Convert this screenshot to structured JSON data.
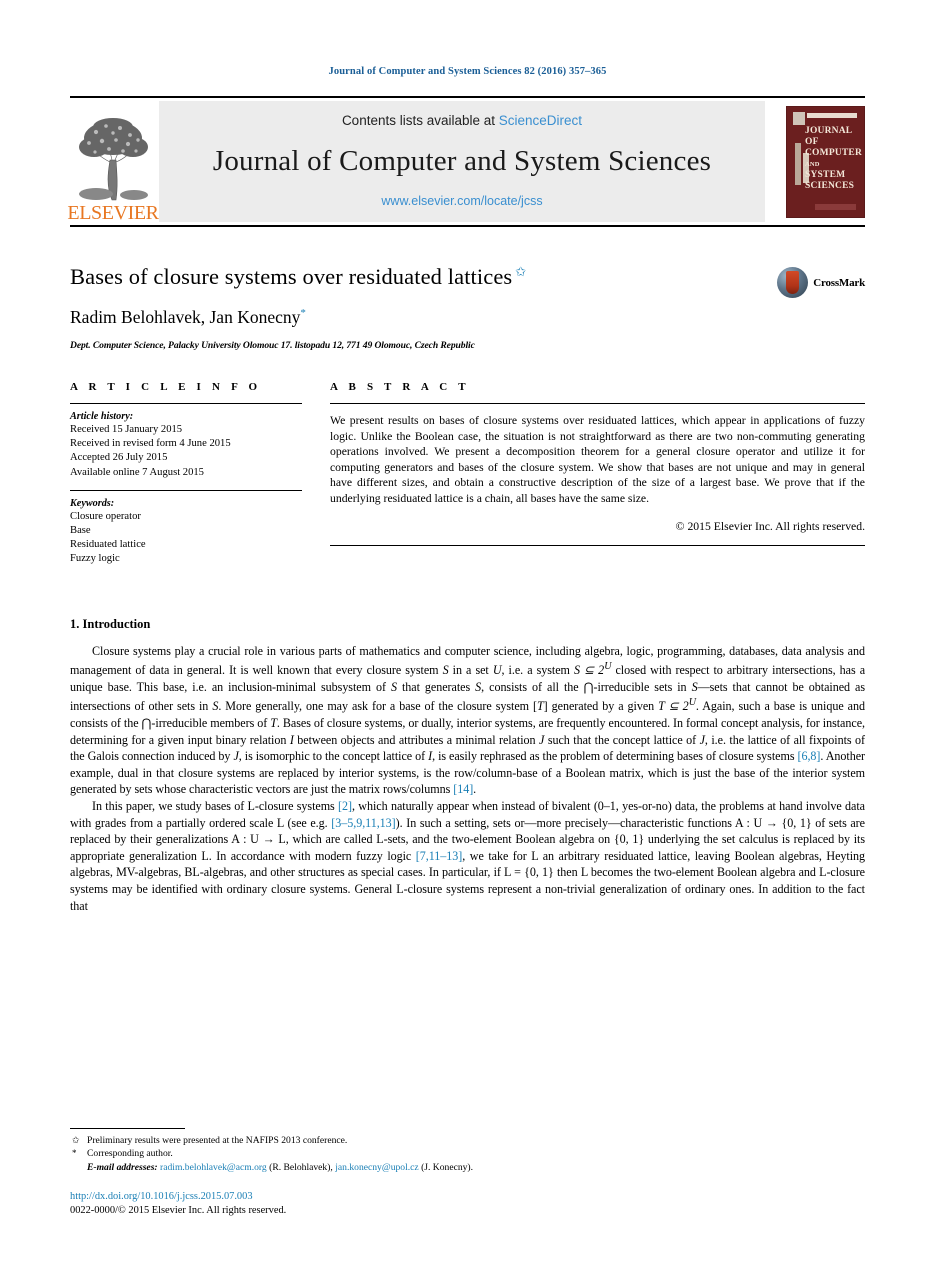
{
  "running_head": "Journal of Computer and System Sciences 82 (2016) 357–365",
  "masthead": {
    "publisher_logo_text": "ELSEVIER",
    "contents_prefix": "Contents lists available at ",
    "contents_link": "ScienceDirect",
    "journal_title": "Journal of Computer and System Sciences",
    "journal_url": "www.elsevier.com/locate/jcss",
    "cover_title_line1": "JOURNAL OF",
    "cover_title_line2": "COMPUTER",
    "cover_title_and": "AND ",
    "cover_title_line3": "SYSTEM",
    "cover_title_line4": "SCIENCES"
  },
  "article": {
    "title": "Bases of closure systems over residuated lattices",
    "title_footnote_mark": "✩",
    "authors": "Radim Belohlavek, Jan Konecny",
    "author_footnote_mark": "*",
    "affiliation": "Dept. Computer Science, Palacky University Olomouc 17. listopadu 12, 771 49 Olomouc, Czech Republic",
    "crossmark_label": "CrossMark"
  },
  "info": {
    "heading": "A R T I C L E   I N F O",
    "history_label": "Article history:",
    "history": [
      "Received 15 January 2015",
      "Received in revised form 4 June 2015",
      "Accepted 26 July 2015",
      "Available online 7 August 2015"
    ],
    "keywords_label": "Keywords:",
    "keywords": [
      "Closure operator",
      "Base",
      "Residuated lattice",
      "Fuzzy logic"
    ]
  },
  "abstract": {
    "heading": "A B S T R A C T",
    "text": "We present results on bases of closure systems over residuated lattices, which appear in applications of fuzzy logic. Unlike the Boolean case, the situation is not straightforward as there are two non-commuting generating operations involved. We present a decomposition theorem for a general closure operator and utilize it for computing generators and bases of the closure system. We show that bases are not unique and may in general have different sizes, and obtain a constructive description of the size of a largest base. We prove that if the underlying residuated lattice is a chain, all bases have the same size.",
    "copyright": "© 2015 Elsevier Inc. All rights reserved."
  },
  "body": {
    "section_number_title": "1. Introduction",
    "paragraph1_part1": "Closure systems play a crucial role in various parts of mathematics and computer science, including algebra, logic, programming, databases, data analysis and management of data in general. It is well known that every closure system ",
    "paragraph1_part2": " in a set ",
    "paragraph1_part3": ", i.e. a system ",
    "paragraph1_part4": " closed with respect to arbitrary intersections, has a unique base. This base, i.e. an inclusion-minimal subsystem of ",
    "paragraph1_part5": " that generates ",
    "paragraph1_part6": ", consists of all the ⋂-irreducible sets in ",
    "paragraph1_part7": "—sets that cannot be obtained as intersections of other sets in ",
    "paragraph1_part8": ". More generally, one may ask for a base of the closure system [",
    "paragraph1_part9": "] generated by a given ",
    "paragraph1_part10": ". Again, such a base is unique and consists of the ⋂-irreducible members of ",
    "paragraph1_part11": ". Bases of closure systems, or dually, interior systems, are frequently encountered. In formal concept analysis, for instance, determining for a given input binary relation ",
    "paragraph1_part12": " between objects and attributes a minimal relation ",
    "paragraph1_part13": " such that the concept lattice of ",
    "paragraph1_part14": ", i.e. the lattice of all fixpoints of the Galois connection induced by ",
    "paragraph1_part15": ", is isomorphic to the concept lattice of ",
    "paragraph1_part16": ", is easily rephrased as the problem of determining bases of closure systems ",
    "paragraph1_ref1": "[6,8]",
    "paragraph1_part17": ". Another example, dual in that closure systems are replaced by interior systems, is the row/column-base of a Boolean matrix, which is just the base of the interior system generated by sets whose characteristic vectors are just the matrix rows/columns ",
    "paragraph1_ref2": "[14]",
    "paragraph1_part18": ".",
    "paragraph2_part1": "In this paper, we study bases of L-closure systems ",
    "paragraph2_ref1": "[2]",
    "paragraph2_part2": ", which naturally appear when instead of bivalent (0–1, yes-or-no) data, the problems at hand involve data with grades from a partially ordered scale L (see e.g. ",
    "paragraph2_ref2": "[3–5,9,11,13]",
    "paragraph2_part3": "). In such a setting, sets or—more precisely—characteristic functions A : U → {0, 1} of sets are replaced by their generalizations A : U → L, which are called L-sets, and the two-element Boolean algebra on {0, 1} underlying the set calculus is replaced by its appropriate generalization L. In accordance with modern fuzzy logic ",
    "paragraph2_ref3": "[7,11–13]",
    "paragraph2_part4": ", we take for L an arbitrary residuated lattice, leaving Boolean algebras, Heyting algebras, MV-algebras, BL-algebras, and other structures as special cases. In particular, if L = {0, 1} then L becomes the two-element Boolean algebra and L-closure systems may be identified with ordinary closure systems. General L-closure systems represent a non-trivial generalization of ordinary ones. In addition to the fact that",
    "sym_S": "S",
    "sym_U": "U",
    "sym_S_sub_2U": "S ⊆ 2",
    "sym_T": "T",
    "sym_T_sub_2U": "T ⊆ 2",
    "sym_sup_U": "U",
    "sym_I": "I",
    "sym_J": "J"
  },
  "footnotes": {
    "note1_mark": "✩",
    "note1": "Preliminary results were presented at the NAFIPS 2013 conference.",
    "note2_mark": "*",
    "note2": "Corresponding author.",
    "emails_label": "E-mail addresses:",
    "email1": "radim.belohlavek@acm.org",
    "email1_owner": "(R. Belohlavek),",
    "email2": "jan.konecny@upol.cz",
    "email2_owner": "(J. Konecny)."
  },
  "imprint": {
    "doi": "http://dx.doi.org/10.1016/j.jcss.2015.07.003",
    "issn_copyright": "0022-0000/© 2015 Elsevier Inc. All rights reserved."
  },
  "colors": {
    "link": "#1a7fb5",
    "sciencedirect": "#3a8fd0",
    "elsevier_orange": "#E87722",
    "cover_maroon": "#6b1f1f"
  }
}
